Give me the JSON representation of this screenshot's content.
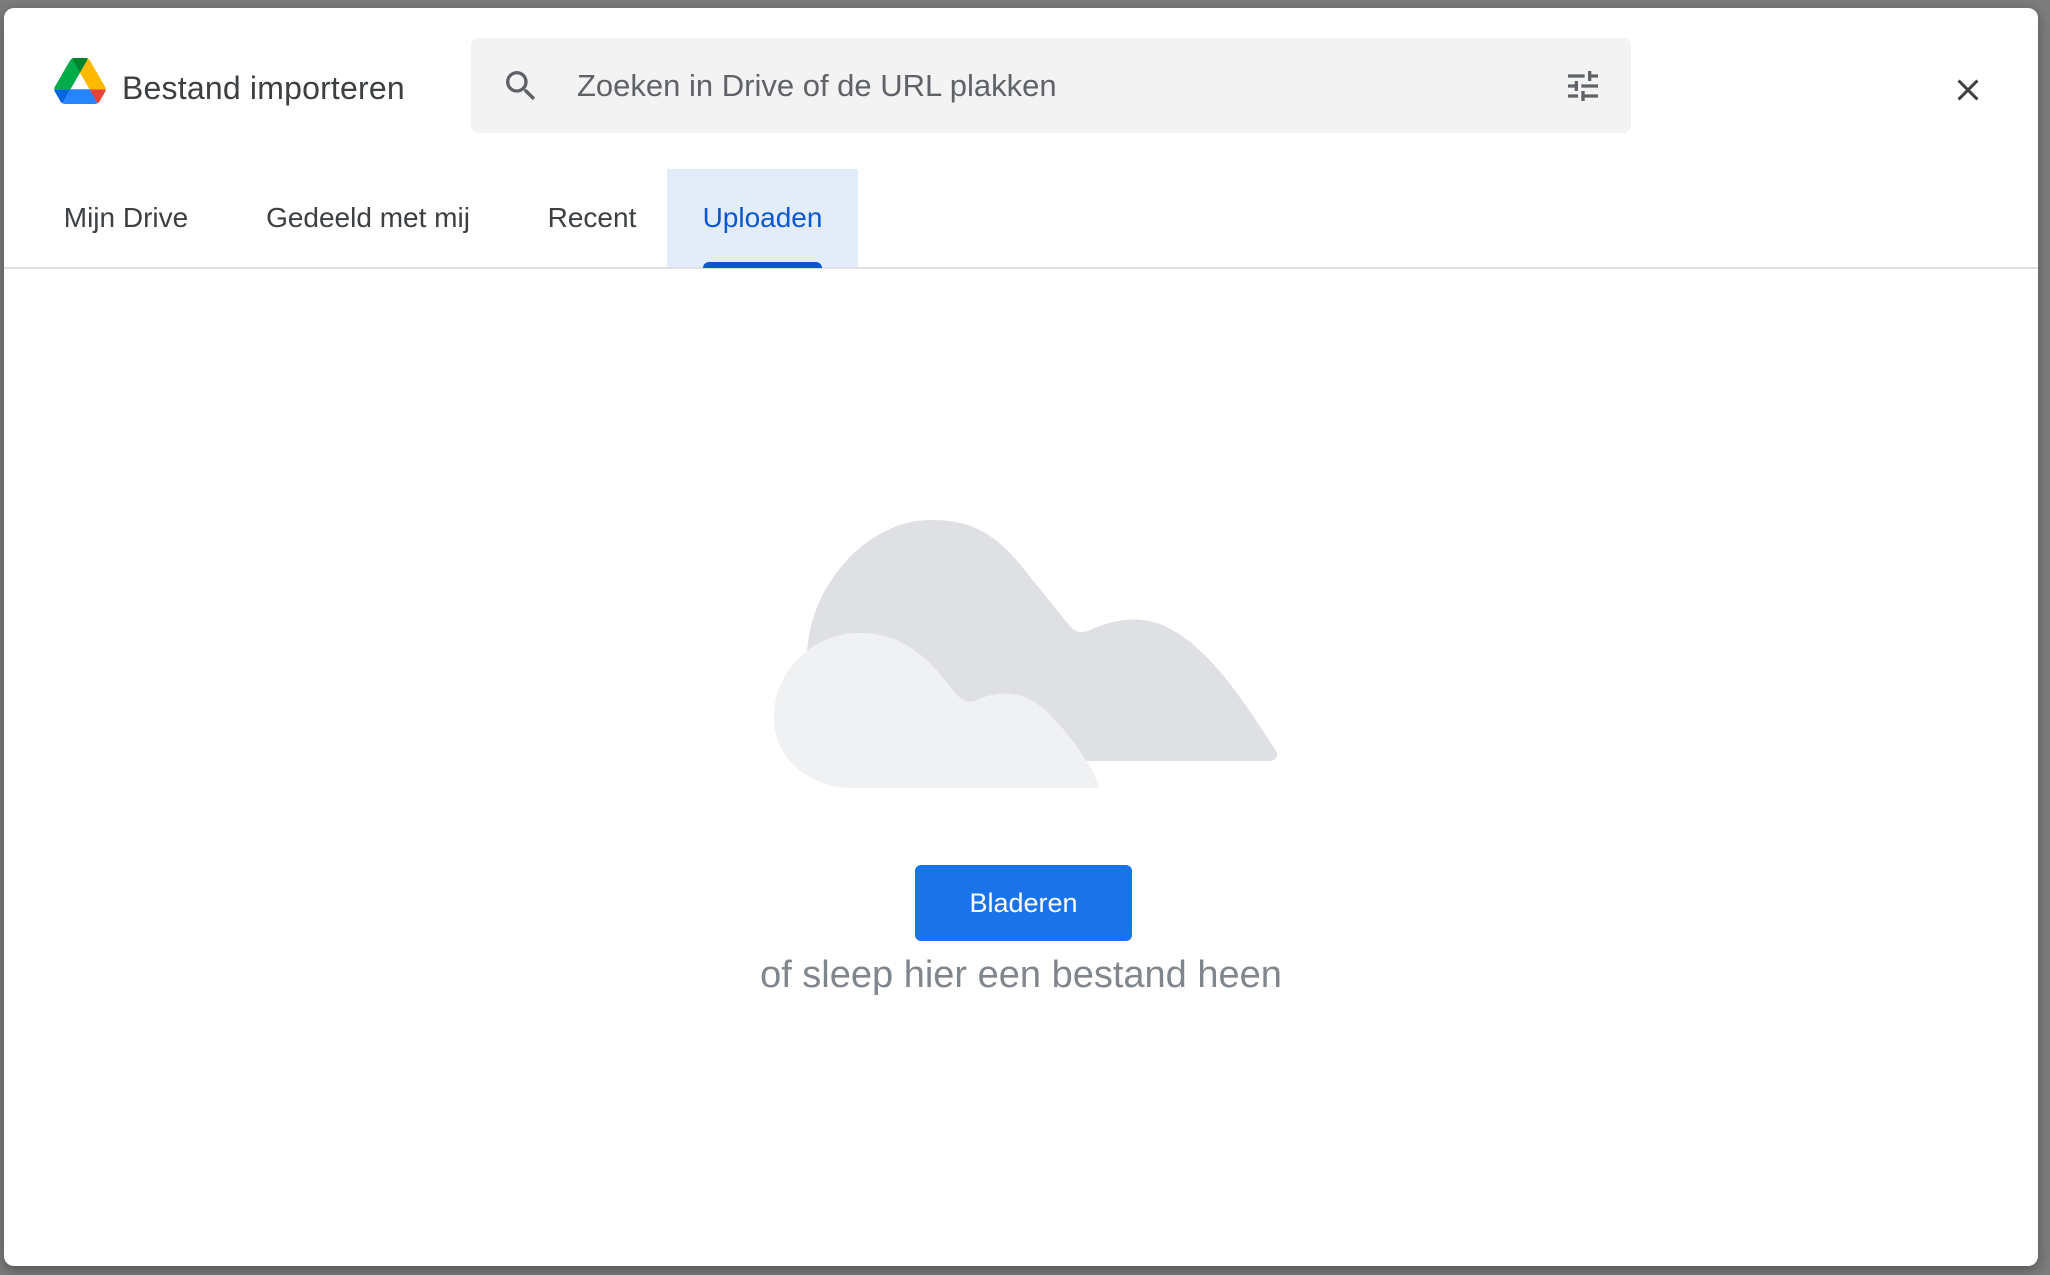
{
  "dialog": {
    "title": "Bestand importeren",
    "close_icon": "close-icon",
    "logo_icon": "google-drive-logo"
  },
  "search": {
    "placeholder": "Zoeken in Drive of de URL plakken",
    "value": "",
    "search_icon": "search-icon",
    "filter_icon": "tune-icon"
  },
  "tabs": [
    {
      "label": "Mijn Drive",
      "active": false
    },
    {
      "label": "Gedeeld met mij",
      "active": false
    },
    {
      "label": "Recent",
      "active": false
    },
    {
      "label": "Uploaden",
      "active": true
    }
  ],
  "upload": {
    "illustration": "cloud-illustration",
    "browse_label": "Bladeren",
    "drop_hint": "of sleep hier een bestand heen"
  },
  "colors": {
    "accent": "#1a73e8",
    "active_tab_text": "#0b57d0",
    "active_tab_bg": "#e3edf9"
  }
}
